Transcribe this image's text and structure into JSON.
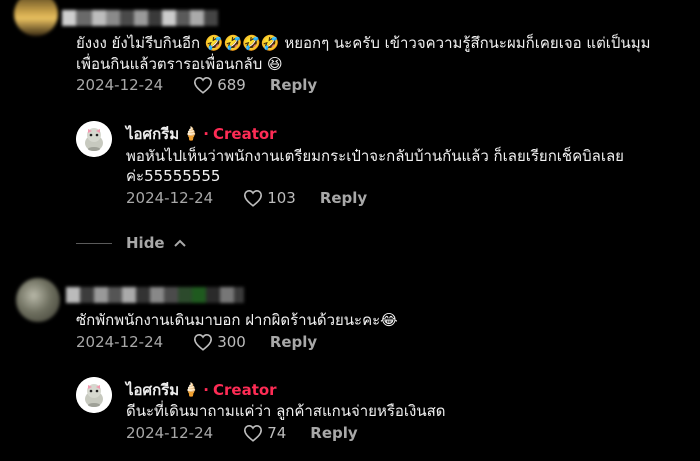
{
  "colors": {
    "background": "#000000",
    "creator_badge": "#fe2c55",
    "meta_text": "#a8a8a8"
  },
  "comments": [
    {
      "text_line1": "ยังงง ยังไม่รีบกินอีก 🤣🤣🤣🤣 หยอกๆ นะครับ เข้าวจความรู้สึกนะผมก็เคยเจอ แต่เป็นมุม",
      "text_line2": "เพื่อนกินแล้วตรารอเพื่อนกลับ 😆",
      "date": "2024-12-24",
      "likes": "689",
      "reply_label": "Reply",
      "reply": {
        "author": "ไอศกรีม",
        "author_icon": "ice-cream-icon",
        "badge": "Creator",
        "separator": "·",
        "text_line1": "พอหันไปเห็นว่าพนักงานเตรียมกระเป๋าจะกลับบ้านกันแล้ว ก็เลยเรียกเช็คบิลเลย",
        "text_line2": "ค่ะ55555555",
        "date": "2024-12-24",
        "likes": "103",
        "reply_label": "Reply"
      }
    },
    {
      "text_line1": "ซักพักพนักงานเดินมาบอก ฝากผิดร้านด้วยนะคะ😂",
      "date": "2024-12-24",
      "likes": "300",
      "reply_label": "Reply",
      "reply": {
        "author": "ไอศกรีม",
        "author_icon": "ice-cream-icon",
        "badge": "Creator",
        "separator": "·",
        "text_line1": "ดีนะที่เดินมาถามแค่ว่า ลูกค้าสแกนจ่ายหรือเงินสด",
        "date": "2024-12-24",
        "likes": "74",
        "reply_label": "Reply"
      }
    }
  ],
  "hide_label": "Hide"
}
